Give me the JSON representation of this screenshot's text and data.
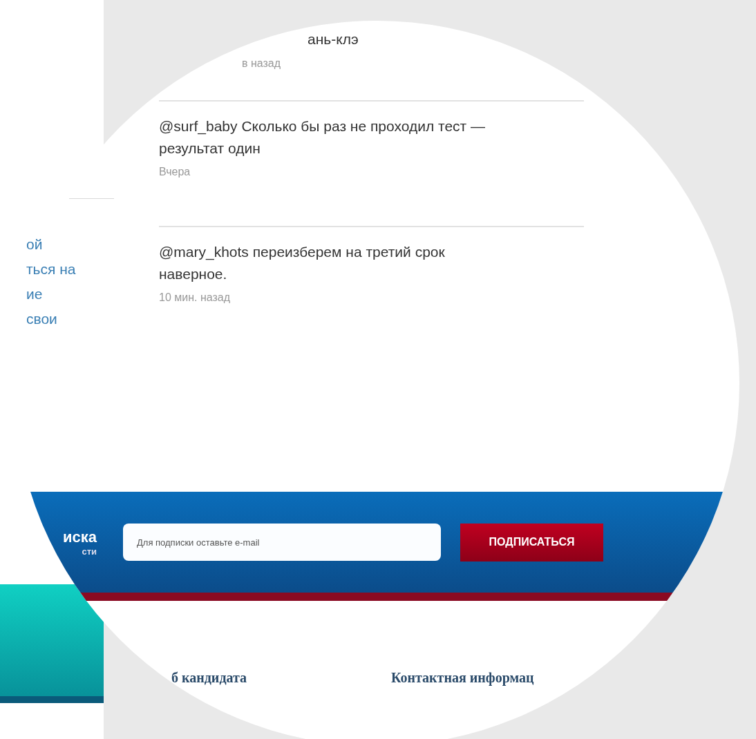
{
  "previous_comment": {
    "text": "ань-клэ",
    "time": "в назад"
  },
  "comments": [
    {
      "text": "@surf_baby Сколько бы раз не проходил тест — результат один",
      "time": "Вчера"
    },
    {
      "text": "@mary_khots переизберем на третий срок наверное.",
      "time": "10 мин. назад"
    }
  ],
  "sidebar_fragment": {
    "lines": [
      "ой",
      "ться на",
      "ие",
      "свои"
    ]
  },
  "subscribe": {
    "title": "иска",
    "subtitle": "сти",
    "placeholder": "Для подписки оставьте e-mail",
    "button": "ПОДПИСАТЬСЯ"
  },
  "footer_links": [
    "б кандидата",
    "Контактная информац"
  ]
}
